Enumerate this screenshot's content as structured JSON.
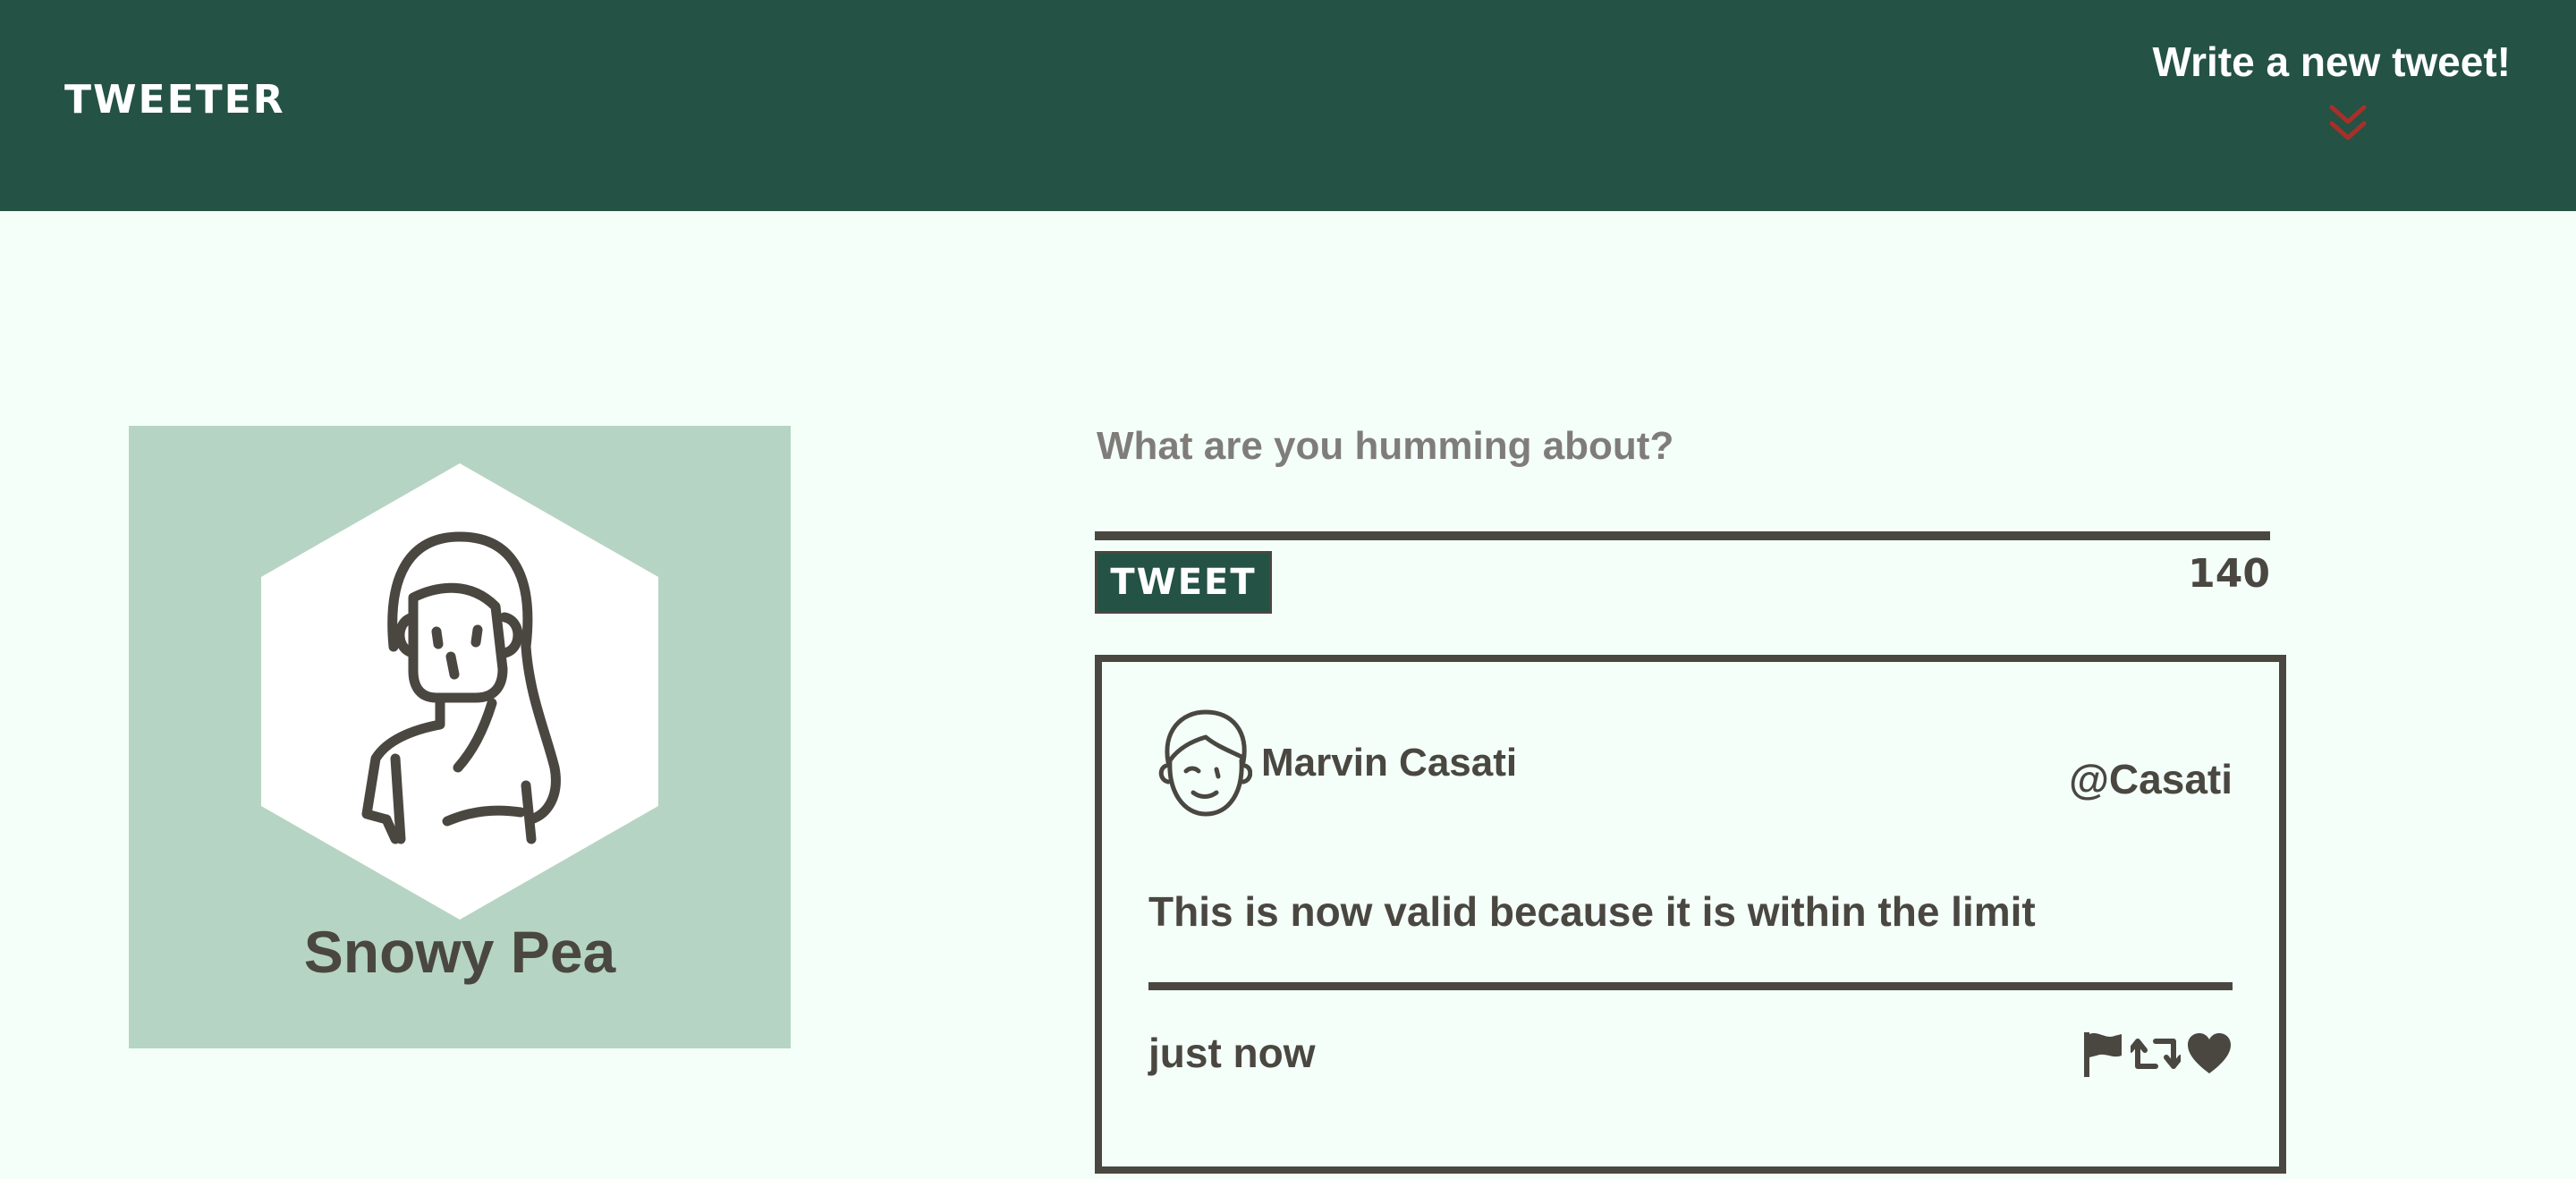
{
  "nav": {
    "brand": "TWEETER",
    "compose_label": "Write a new tweet!",
    "chevron_icon": "double-chevron-down-icon",
    "chevron_color": "#a8302a",
    "background": "#245244"
  },
  "profile": {
    "name": "Snowy Pea",
    "avatar_icon": "girl-avatar-icon",
    "background": "#b6d4c3"
  },
  "composer": {
    "placeholder": "What are you humming about?",
    "value": "",
    "button_label": "TWEET",
    "counter": "140"
  },
  "tweets": [
    {
      "avatar_icon": "boy-avatar-icon",
      "name": "Marvin Casati",
      "handle": "@Casati",
      "text": "This is now valid because it is within the limit",
      "time": "just now",
      "actions": [
        "flag-icon",
        "retweet-icon",
        "heart-icon"
      ]
    }
  ],
  "colors": {
    "page_background": "#f4fffa",
    "text": "#4a4741",
    "accent": "#245244"
  }
}
